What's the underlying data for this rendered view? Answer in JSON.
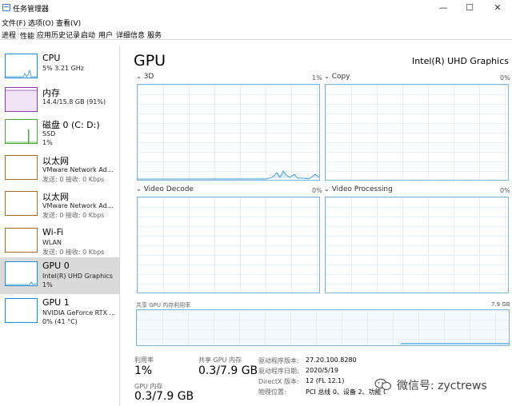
{
  "window": {
    "title": "任务管理器",
    "minimize_glyph": "—",
    "maximize_glyph": "☐",
    "close_glyph": "✕"
  },
  "menu": [
    "文件(F)",
    "选项(O)",
    "查看(V)"
  ],
  "tabs": [
    {
      "label": "进程",
      "active": false
    },
    {
      "label": "性能",
      "active": true
    },
    {
      "label": "应用历史记录",
      "active": false
    },
    {
      "label": "启动",
      "active": false
    },
    {
      "label": "用户",
      "active": false
    },
    {
      "label": "详细信息",
      "active": false
    },
    {
      "label": "服务",
      "active": false
    }
  ],
  "sidebar": [
    {
      "title": "CPU",
      "line1": "5% 3.21 GHz",
      "line2": "",
      "color": "#1f8bd1",
      "selected": false
    },
    {
      "title": "内存",
      "line1": "14.4/15.8 GB (91%)",
      "line2": "",
      "color": "#8b3fa6",
      "selected": false
    },
    {
      "title": "磁盘 0 (C: D:)",
      "line1": "SSD",
      "line2": "1%",
      "color": "#4da63a",
      "selected": false
    },
    {
      "title": "以太网",
      "line1": "VMware Network Ad...",
      "line2": "发送: 0 接收: 0 Kbps",
      "color": "#a86b2a",
      "selected": false
    },
    {
      "title": "以太网",
      "line1": "VMware Network Ad...",
      "line2": "发送: 0 接收: 0 Kbps",
      "color": "#a86b2a",
      "selected": false
    },
    {
      "title": "Wi-Fi",
      "line1": "WLAN",
      "line2": "发送: 0 接收: 0 Kbps",
      "color": "#a86b2a",
      "selected": false
    },
    {
      "title": "GPU 0",
      "line1": "Intel(R) UHD Graphics",
      "line2": "1%",
      "color": "#1f8bd1",
      "selected": true
    },
    {
      "title": "GPU 1",
      "line1": "NVIDIA GeForce RTX ...",
      "line2": "0% (41 °C)",
      "color": "#1f8bd1",
      "selected": false
    }
  ],
  "main": {
    "title": "GPU",
    "device_name": "Intel(R) UHD Graphics",
    "graphs": [
      {
        "label": "3D",
        "percent": "1%"
      },
      {
        "label": "Copy",
        "percent": "0%"
      },
      {
        "label": "Video Decode",
        "percent": "0%"
      },
      {
        "label": "Video Processing",
        "percent": "0%"
      }
    ],
    "shared_memory": {
      "label": "共享 GPU 内存利用率",
      "max": "7.9 GB"
    },
    "stats": {
      "utilization": {
        "label": "利用率",
        "value": "1%"
      },
      "shared_gpu_mem": {
        "label": "共享 GPU 内存",
        "value": "0.3/7.9 GB"
      },
      "gpu_mem": {
        "label": "GPU 内存",
        "value": "0.3/7.9 GB"
      }
    },
    "info": [
      {
        "label": "驱动程序版本:",
        "value": "27.20.100.8280"
      },
      {
        "label": "驱动程序日期:",
        "value": "2020/5/19"
      },
      {
        "label": "DirectX 版本:",
        "value": "12 (FL 12.1)"
      },
      {
        "label": "物理位置:",
        "value": "PCI 总线 0、设备 2、功能 0"
      }
    ]
  },
  "watermark": {
    "text": "微信号: zyctrews",
    "icon": "wechat-icon"
  }
}
